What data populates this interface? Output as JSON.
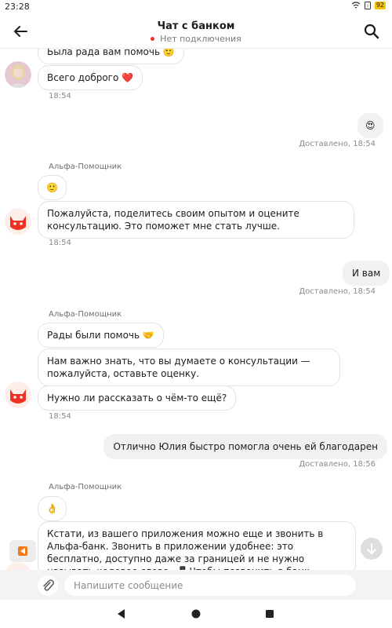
{
  "status_bar": {
    "time": "23:28",
    "battery": "92"
  },
  "header": {
    "title": "Чат с банком",
    "connection_status": "Нет подключения"
  },
  "messages": {
    "m1": {
      "text": "Была рада вам помочь 🙂"
    },
    "m2": {
      "text": "Всего доброго ❤️",
      "time": "18:54"
    },
    "m3": {
      "text": "😍",
      "status": "Доставлено, 18:54"
    },
    "m4": {
      "sender": "Альфа-Помощник",
      "text": "🙂"
    },
    "m5": {
      "text": "Пожалуйста, поделитесь своим опытом и оцените консультацию. Это поможет мне стать лучше.",
      "time": "18:54"
    },
    "m6": {
      "text": "И вам",
      "status": "Доставлено, 18:54"
    },
    "m7": {
      "sender": "Альфа-Помощник",
      "text": "Рады были помочь 🤝"
    },
    "m8": {
      "text": "Нам важно знать, что вы думаете о консультации — пожалуйста, оставьте оценку."
    },
    "m9": {
      "text": "Нужно ли рассказать о чём-то ещё?",
      "time": "18:54"
    },
    "m10": {
      "text": "Отлично Юлия быстро помогла очень ей благодарен",
      "status": "Доставлено, 18:56"
    },
    "m11": {
      "sender": "Альфа-Помощник",
      "text": "👌"
    },
    "m12": {
      "text": "Кстати, из вашего приложения можно еще и звонить в Альфа-банк. Звонить в приложении удобнее: это бесплатно, доступно даже за границей и не нужно называть кодовое слово. 📲 Чтобы позвонить в банк, нажмите на значок трубки вверху"
    }
  },
  "composer": {
    "placeholder": "Напишите сообщение"
  },
  "colors": {
    "accent": "#ef3124",
    "outgoing_bubble": "#f1f1f3",
    "incoming_border": "#e3e3e3"
  },
  "icons": [
    "back-arrow-icon",
    "search-icon",
    "paperclip-icon",
    "arrow-down-icon",
    "play-icon",
    "nav-back-icon",
    "nav-home-icon",
    "nav-recents-icon"
  ]
}
